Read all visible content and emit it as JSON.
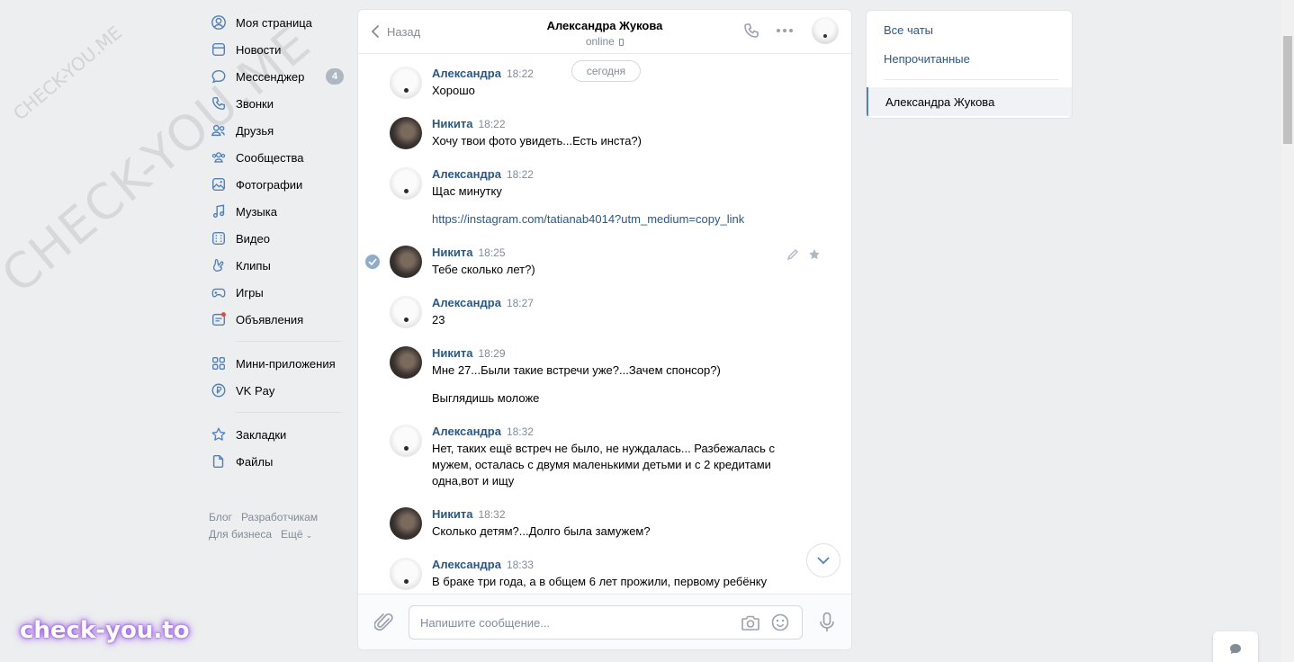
{
  "nav": {
    "items": [
      {
        "label": "Моя страница",
        "icon": "user-circle-icon"
      },
      {
        "label": "Новости",
        "icon": "news-icon"
      },
      {
        "label": "Мессенджер",
        "icon": "message-icon",
        "badge": "4"
      },
      {
        "label": "Звонки",
        "icon": "phone-icon"
      },
      {
        "label": "Друзья",
        "icon": "friends-icon"
      },
      {
        "label": "Сообщества",
        "icon": "communities-icon"
      },
      {
        "label": "Фотографии",
        "icon": "photo-icon"
      },
      {
        "label": "Музыка",
        "icon": "music-icon"
      },
      {
        "label": "Видео",
        "icon": "video-icon"
      },
      {
        "label": "Клипы",
        "icon": "clips-icon"
      },
      {
        "label": "Игры",
        "icon": "gamepad-icon"
      },
      {
        "label": "Объявления",
        "icon": "ads-icon"
      }
    ],
    "items2": [
      {
        "label": "Мини-приложения",
        "icon": "apps-icon"
      },
      {
        "label": "VK Pay",
        "icon": "vkpay-icon"
      }
    ],
    "items3": [
      {
        "label": "Закладки",
        "icon": "star-icon"
      },
      {
        "label": "Файлы",
        "icon": "file-icon"
      }
    ],
    "footer": {
      "blog": "Блог",
      "dev": "Разработчикам",
      "business": "Для бизнеса",
      "more": "Ещё"
    }
  },
  "chat": {
    "back": "Назад",
    "peer_name": "Александра Жукова",
    "peer_status": "online",
    "today": "сегодня",
    "messages": [
      {
        "author": "Александра",
        "time": "18:22",
        "lines": [
          "Хорошо"
        ]
      },
      {
        "author": "Никита",
        "time": "18:22",
        "lines": [
          "Хочу твои фото увидеть...Есть инста?)"
        ]
      },
      {
        "author": "Александра",
        "time": "18:22",
        "lines": [
          "Щас минутку"
        ],
        "link": "https://instagram.com/tatianab4014?utm_medium=copy_link"
      },
      {
        "author": "Никита",
        "time": "18:25",
        "lines": [
          "Тебе сколько лет?)"
        ]
      },
      {
        "author": "Александра",
        "time": "18:27",
        "lines": [
          "23"
        ]
      },
      {
        "author": "Никита",
        "time": "18:29",
        "lines": [
          "Мне 27...Были такие встречи уже?...Зачем спонсор?)"
        ],
        "extra": "Выглядишь моложе"
      },
      {
        "author": "Александра",
        "time": "18:32",
        "lines": [
          "Нет, таких ещё встреч не было, не нуждалась... Разбежалась с",
          "мужем, осталась с двумя маленькими детьми и с 2 кредитами",
          "одна,вот и ищу"
        ]
      },
      {
        "author": "Никита",
        "time": "18:32",
        "lines": [
          "Сколько детям?...Долго была замужем?"
        ]
      },
      {
        "author": "Александра",
        "time": "18:33",
        "lines": [
          "В браке три года, а в общем 6 лет прожили, первому ребёнку"
        ]
      }
    ],
    "composer_placeholder": "Напишите сообщение..."
  },
  "right": {
    "all_chats": "Все чаты",
    "unread": "Непрочитанные",
    "active_chat": "Александра Жукова"
  },
  "watermarks": {
    "big": "CHECK-YOU.ME",
    "small": "CHECK-YOU.ME",
    "brand": "check-you.to"
  }
}
